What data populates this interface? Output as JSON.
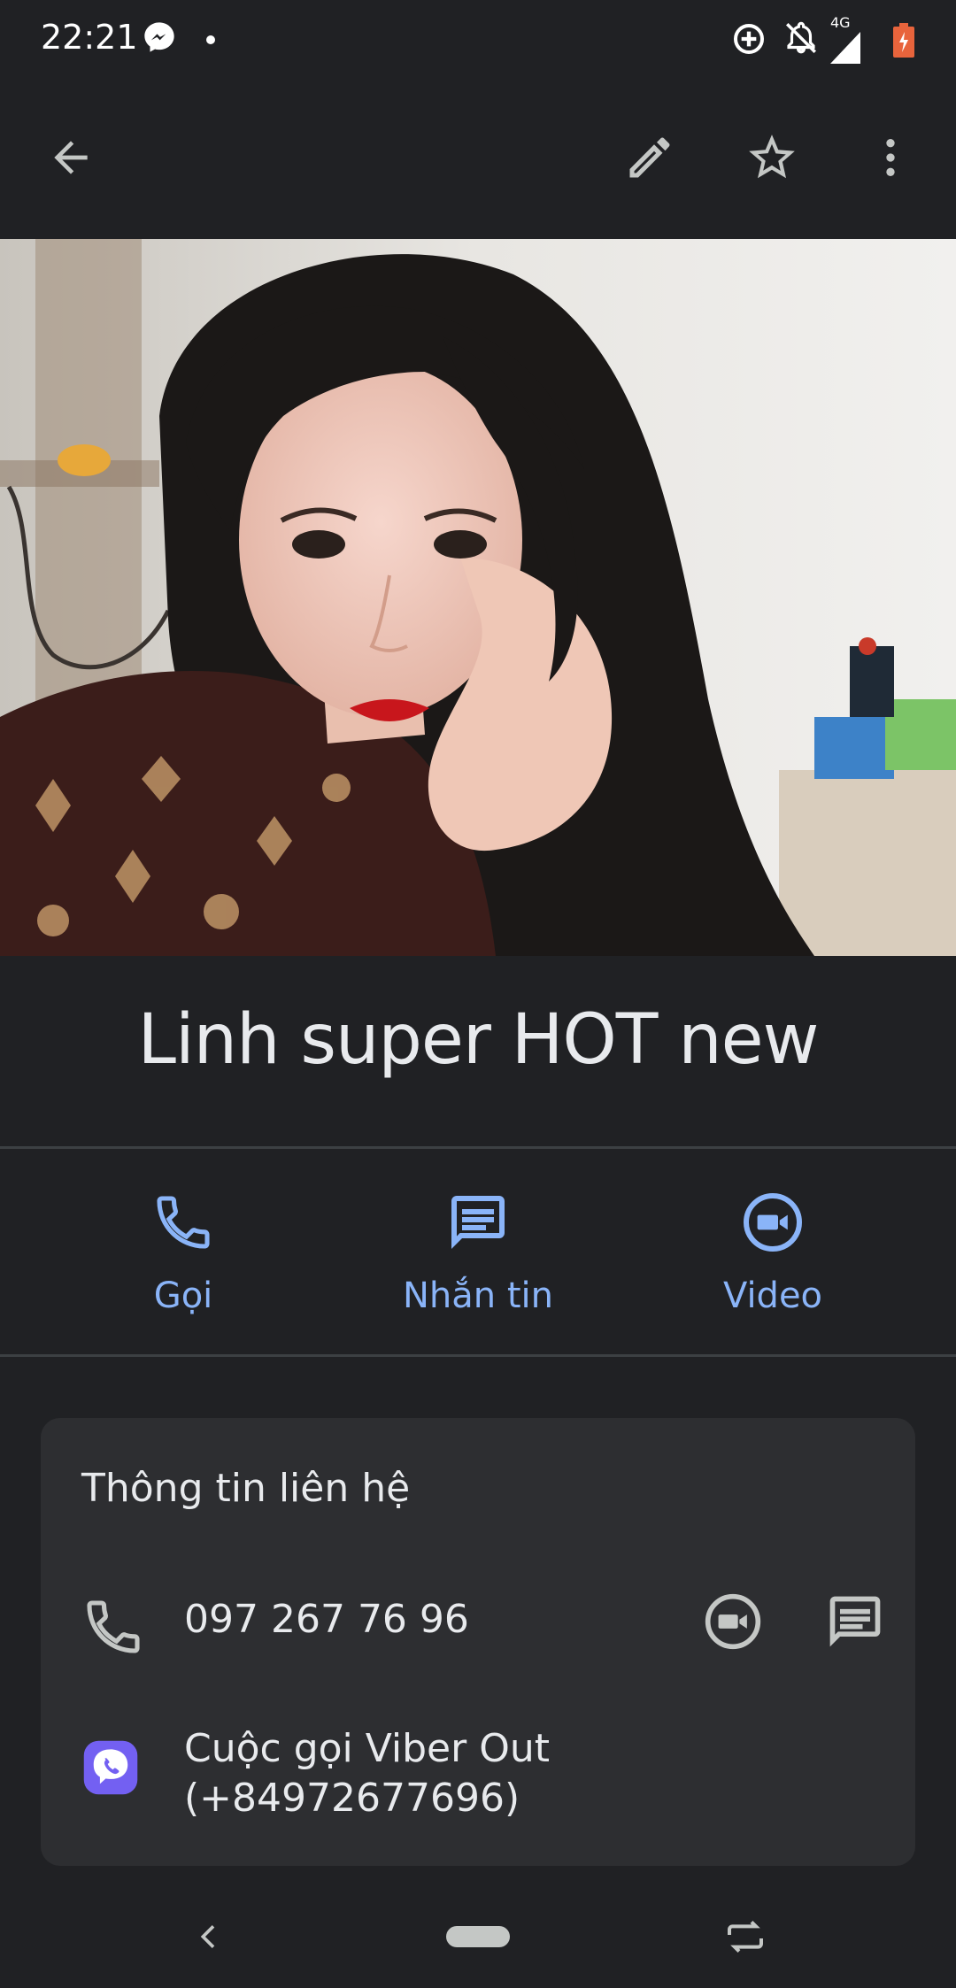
{
  "status_bar": {
    "time": "22:21",
    "left_icons": [
      "messenger-icon",
      "dot-icon"
    ],
    "right_icons": [
      "data-saver-icon",
      "notifications-off-icon",
      "signal-4g-icon",
      "battery-icon"
    ],
    "network_label": "4G",
    "battery_color": "#e8643c"
  },
  "app_bar": {
    "back_icon": "arrow-back-icon",
    "edit_icon": "pencil-icon",
    "star_icon": "star-outline-icon",
    "more_icon": "more-vert-icon"
  },
  "contact": {
    "name": "Linh super HOT new"
  },
  "actions": [
    {
      "label": "Gọi",
      "icon": "phone-icon"
    },
    {
      "label": "Nhắn tin",
      "icon": "message-icon"
    },
    {
      "label": "Video",
      "icon": "video-call-icon"
    }
  ],
  "contact_info": {
    "title": "Thông tin liên hệ",
    "phone": {
      "number": "097 267 76 96",
      "icon": "phone-icon",
      "video_icon": "video-call-icon",
      "message_icon": "message-icon"
    },
    "viber": {
      "line1": "Cuộc gọi Viber Out",
      "line2": "(+84972677696)",
      "icon": "viber-icon",
      "brand_color": "#7360f2"
    }
  },
  "nav_bar": {
    "back_icon": "nav-back-icon",
    "home_icon": "home-pill-icon",
    "recents_icon": "rotate-icon"
  },
  "colors": {
    "background": "#202124",
    "card": "#2d2e31",
    "accent": "#8ab4f8",
    "text": "#e8eaed",
    "divider": "#3c4043"
  }
}
